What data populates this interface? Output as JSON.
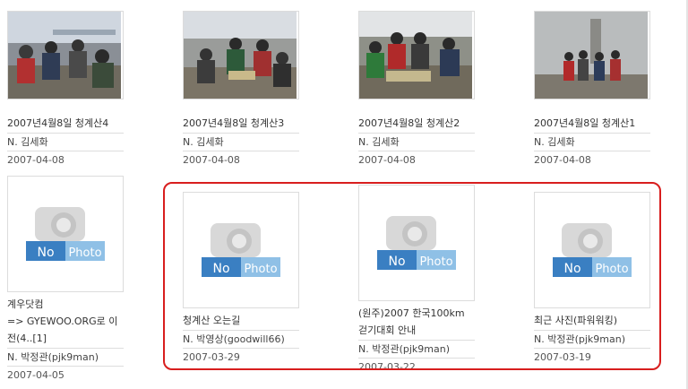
{
  "gallery": {
    "items": [
      {
        "title": "2007년4월8일 청계산4",
        "author": "N. 김세화",
        "date": "2007-04-08",
        "has_photo": true
      },
      {
        "title": "2007년4월8일 청계산3",
        "author": "N. 김세화",
        "date": "2007-04-08",
        "has_photo": true
      },
      {
        "title": "2007년4월8일 청계산2",
        "author": "N. 김세화",
        "date": "2007-04-08",
        "has_photo": true
      },
      {
        "title": "2007년4월8일 청계산1",
        "author": "N. 김세화",
        "date": "2007-04-08",
        "has_photo": true
      },
      {
        "title_lines": [
          "계우닷컴",
          "=> GYEWOO.ORG로 이",
          "전(4..[1]"
        ],
        "author": "N. 박정관(pjk9man)",
        "date": "2007-04-05",
        "has_photo": false
      },
      {
        "title": "청계산 오는길",
        "author": "N. 박영상(goodwill66)",
        "date": "2007-03-29",
        "has_photo": false
      },
      {
        "title_lines": [
          "(원주)2007 한국100km",
          "걷기대회 안내"
        ],
        "author": "N. 박정관(pjk9man)",
        "date": "2007-03-22",
        "has_photo": false
      },
      {
        "title": "최근 사진(파워워킹)",
        "author": "N. 박정관(pjk9man)",
        "date": "2007-03-19",
        "has_photo": false
      }
    ],
    "no_photo_label": {
      "no": "No",
      "photo": "Photo"
    },
    "colors": {
      "highlight": "#d81e1e",
      "no_photo_blue": "#3a7fc2",
      "no_photo_light": "#8fc0e6"
    }
  }
}
